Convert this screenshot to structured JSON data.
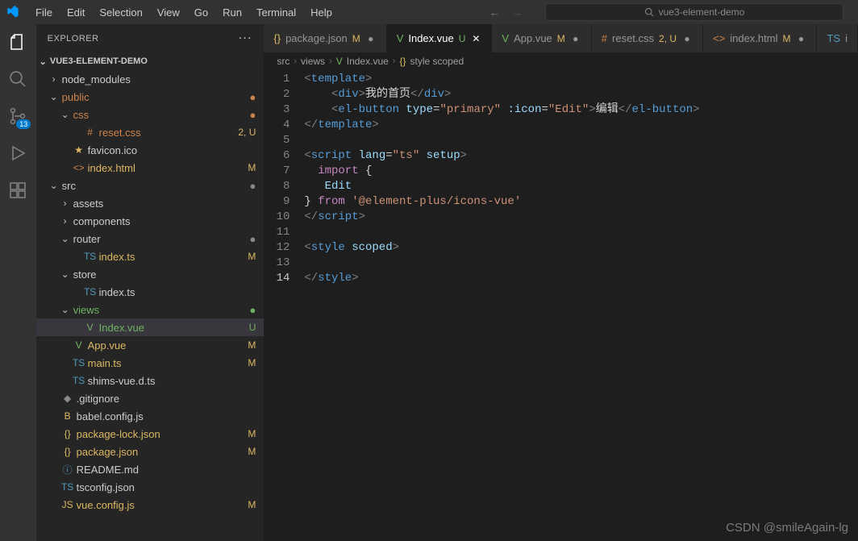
{
  "titlebar": {
    "menus": [
      "File",
      "Edit",
      "Selection",
      "View",
      "Go",
      "Run",
      "Terminal",
      "Help"
    ],
    "search_placeholder": "vue3-element-demo"
  },
  "activitybar": {
    "scm_badge": "13"
  },
  "sidebar": {
    "title": "EXPLORER",
    "project": "VUE3-ELEMENT-DEMO",
    "tree": [
      {
        "depth": 0,
        "type": "folder",
        "open": false,
        "label": "node_modules",
        "color": "",
        "decor": "",
        "dot": ""
      },
      {
        "depth": 0,
        "type": "folder",
        "open": true,
        "label": "public",
        "color": "o",
        "decor": "",
        "dot": "dot-o"
      },
      {
        "depth": 1,
        "type": "folder",
        "open": true,
        "label": "css",
        "color": "o",
        "decor": "",
        "dot": "dot-o"
      },
      {
        "depth": 2,
        "type": "file",
        "icon": "#",
        "iconClass": "o",
        "label": "reset.css",
        "color": "o",
        "decor": "2, U",
        "decorClass": "status-2U"
      },
      {
        "depth": 1,
        "type": "file",
        "icon": "★",
        "iconClass": "y",
        "label": "favicon.ico",
        "color": "",
        "decor": ""
      },
      {
        "depth": 1,
        "type": "file",
        "icon": "<>",
        "iconClass": "o",
        "label": "index.html",
        "color": "y",
        "decor": "M",
        "decorClass": "status-M"
      },
      {
        "depth": 0,
        "type": "folder",
        "open": true,
        "label": "src",
        "color": "",
        "decor": "",
        "dot": "dot-gr"
      },
      {
        "depth": 1,
        "type": "folder",
        "open": false,
        "label": "assets",
        "color": "",
        "decor": ""
      },
      {
        "depth": 1,
        "type": "folder",
        "open": false,
        "label": "components",
        "color": "",
        "decor": ""
      },
      {
        "depth": 1,
        "type": "folder",
        "open": true,
        "label": "router",
        "color": "",
        "decor": "",
        "dot": "dot-gr"
      },
      {
        "depth": 2,
        "type": "file",
        "icon": "TS",
        "iconClass": "b",
        "label": "index.ts",
        "color": "y",
        "decor": "M",
        "decorClass": "status-M"
      },
      {
        "depth": 1,
        "type": "folder",
        "open": true,
        "label": "store",
        "color": "",
        "decor": ""
      },
      {
        "depth": 2,
        "type": "file",
        "icon": "TS",
        "iconClass": "b",
        "label": "index.ts",
        "color": "",
        "decor": ""
      },
      {
        "depth": 1,
        "type": "folder",
        "open": true,
        "label": "views",
        "color": "g",
        "decor": "",
        "dot": "dot-g",
        "selectedParent": true
      },
      {
        "depth": 2,
        "type": "file",
        "icon": "V",
        "iconClass": "g",
        "label": "Index.vue",
        "color": "g",
        "decor": "U",
        "decorClass": "status-U",
        "selected": true
      },
      {
        "depth": 1,
        "type": "file",
        "icon": "V",
        "iconClass": "g",
        "label": "App.vue",
        "color": "y",
        "decor": "M",
        "decorClass": "status-M"
      },
      {
        "depth": 1,
        "type": "file",
        "icon": "TS",
        "iconClass": "b",
        "label": "main.ts",
        "color": "y",
        "decor": "M",
        "decorClass": "status-M"
      },
      {
        "depth": 1,
        "type": "file",
        "icon": "TS",
        "iconClass": "b",
        "label": "shims-vue.d.ts",
        "color": "",
        "decor": ""
      },
      {
        "depth": 0,
        "type": "file",
        "icon": "◆",
        "iconClass": "gr",
        "label": ".gitignore",
        "color": "",
        "decor": ""
      },
      {
        "depth": 0,
        "type": "file",
        "icon": "B",
        "iconClass": "y",
        "label": "babel.config.js",
        "color": "",
        "decor": ""
      },
      {
        "depth": 0,
        "type": "file",
        "icon": "{}",
        "iconClass": "y",
        "label": "package-lock.json",
        "color": "y",
        "decor": "M",
        "decorClass": "status-M"
      },
      {
        "depth": 0,
        "type": "file",
        "icon": "{}",
        "iconClass": "y",
        "label": "package.json",
        "color": "y",
        "decor": "M",
        "decorClass": "status-M"
      },
      {
        "depth": 0,
        "type": "file",
        "icon": "ⓘ",
        "iconClass": "b",
        "label": "README.md",
        "color": "",
        "decor": ""
      },
      {
        "depth": 0,
        "type": "file",
        "icon": "TS",
        "iconClass": "b",
        "label": "tsconfig.json",
        "color": "",
        "decor": ""
      },
      {
        "depth": 0,
        "type": "file",
        "icon": "JS",
        "iconClass": "y",
        "label": "vue.config.js",
        "color": "y",
        "decor": "M",
        "decorClass": "status-M"
      }
    ]
  },
  "tabs": [
    {
      "icon": "{}",
      "iconClass": "y",
      "label": "package.json",
      "status": "M",
      "statusClass": "status-M",
      "active": false,
      "dirty": true
    },
    {
      "icon": "V",
      "iconClass": "g",
      "label": "Index.vue",
      "status": "U",
      "statusClass": "status-U",
      "active": true,
      "dirty": false,
      "close": true
    },
    {
      "icon": "V",
      "iconClass": "g",
      "label": "App.vue",
      "status": "M",
      "statusClass": "status-M",
      "active": false,
      "dirty": true
    },
    {
      "icon": "#",
      "iconClass": "o",
      "label": "reset.css",
      "status": "2, U",
      "statusClass": "status-2U",
      "active": false,
      "dirty": true
    },
    {
      "icon": "<>",
      "iconClass": "o",
      "label": "index.html",
      "status": "M",
      "statusClass": "status-M",
      "active": false,
      "dirty": true
    },
    {
      "icon": "TS",
      "iconClass": "b",
      "label": "i",
      "status": "",
      "statusClass": "",
      "active": false,
      "overflow": true
    }
  ],
  "breadcrumbs": [
    "src",
    "views",
    "Index.vue",
    "style scoped"
  ],
  "breadcrumb_icons": [
    "",
    "",
    "V",
    "{}"
  ],
  "code": {
    "lines": [
      {
        "n": 1,
        "html": "<span class='c-tag'>&lt;</span><span class='c-name'>template</span><span class='c-tag'>&gt;</span>"
      },
      {
        "n": 2,
        "html": "    <span class='c-tag'>&lt;</span><span class='c-name'>div</span><span class='c-tag'>&gt;</span><span class='c-text'>我的首页</span><span class='c-tag'>&lt;/</span><span class='c-name'>div</span><span class='c-tag'>&gt;</span>"
      },
      {
        "n": 3,
        "html": "    <span class='c-tag'>&lt;</span><span class='c-name'>el-button</span> <span class='c-attr'>type</span><span class='c-pun'>=</span><span class='c-str'>\"primary\"</span> <span class='c-attr'>:icon</span><span class='c-pun'>=</span><span class='c-str'>\"Edit\"</span><span class='c-tag'>&gt;</span><span class='c-text'>编辑</span><span class='c-tag'>&lt;/</span><span class='c-name'>el-button</span><span class='c-tag'>&gt;</span>"
      },
      {
        "n": 4,
        "html": "<span class='c-tag'>&lt;/</span><span class='c-name'>template</span><span class='c-tag'>&gt;</span>"
      },
      {
        "n": 5,
        "html": ""
      },
      {
        "n": 6,
        "html": "<span class='c-tag'>&lt;</span><span class='c-name'>script</span> <span class='c-attr'>lang</span><span class='c-pun'>=</span><span class='c-str'>\"ts\"</span> <span class='c-attr'>setup</span><span class='c-tag'>&gt;</span>"
      },
      {
        "n": 7,
        "html": "  <span class='c-kw'>import</span> <span class='c-pun'>{</span>"
      },
      {
        "n": 8,
        "html": "   <span class='c-fn'>Edit</span>"
      },
      {
        "n": 9,
        "html": "<span class='c-pun'>}</span> <span class='c-kw'>from</span> <span class='c-str'>'@element-plus/icons-vue'</span>"
      },
      {
        "n": 10,
        "html": "<span class='c-tag'>&lt;/</span><span class='c-name'>script</span><span class='c-tag'>&gt;</span>"
      },
      {
        "n": 11,
        "html": ""
      },
      {
        "n": 12,
        "html": "<span class='c-tag'>&lt;</span><span class='c-name'>style</span> <span class='c-attr'>scoped</span><span class='c-tag'>&gt;</span>"
      },
      {
        "n": 13,
        "html": ""
      },
      {
        "n": 14,
        "current": true,
        "html": "<span class='c-tag'>&lt;/</span><span class='c-name'>style</span><span class='c-tag'>&gt;</span>"
      }
    ]
  },
  "watermark": "CSDN @smileAgain-lg"
}
